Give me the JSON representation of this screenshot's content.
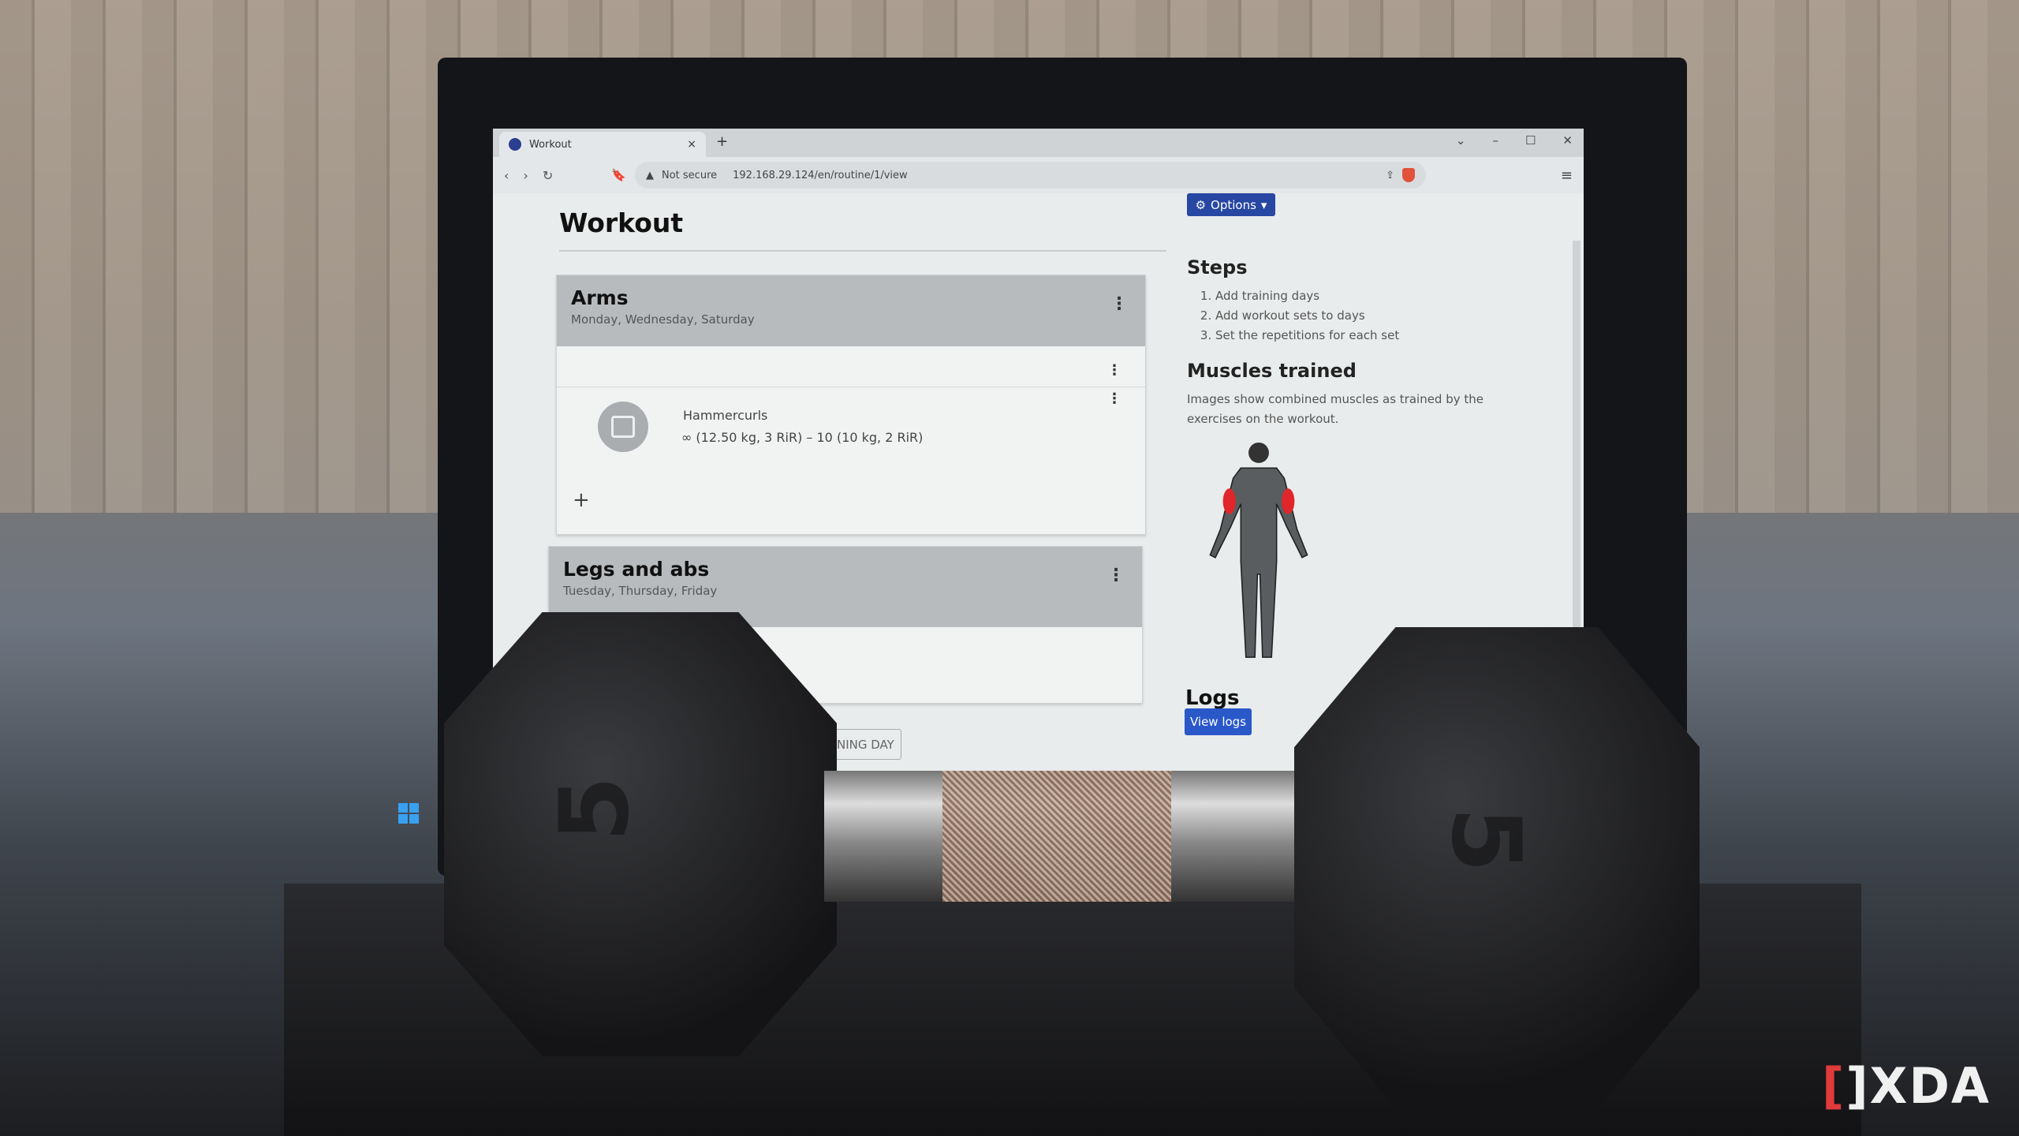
{
  "browser": {
    "tab_title": "Workout",
    "security_label": "Not secure",
    "url": "192.168.29.124/en/routine/1/view"
  },
  "page": {
    "title": "Workout",
    "options_label": "Options",
    "days": [
      {
        "name": "Arms",
        "weekdays": "Monday, Wednesday, Saturday",
        "exercises": [
          {
            "name": "Hammercurls",
            "sets": "∞ (12.50 kg, 3 RiR) – 10 (10 kg, 2 RiR)"
          }
        ]
      },
      {
        "name": "Legs and abs",
        "weekdays": "Tuesday, Thursday, Friday",
        "exercises": []
      }
    ],
    "add_day_label": "ADD TRAINING DAY",
    "sidebar": {
      "steps_title": "Steps",
      "steps": [
        "Add training days",
        "Add workout sets to days",
        "Set the repetitions for each set"
      ],
      "muscles_title": "Muscles trained",
      "muscles_text": "Images show combined muscles as trained by the exercises on the workout.",
      "highlighted_muscles": [
        "biceps"
      ],
      "highlight_color": "#e0262b",
      "logs_title": "Logs",
      "view_logs_label": "View logs"
    }
  },
  "colors": {
    "primary": "#2747a3",
    "logs_button": "#2a58c9"
  },
  "photo": {
    "dumbbell_weight": "5",
    "watermark": "XDA"
  }
}
